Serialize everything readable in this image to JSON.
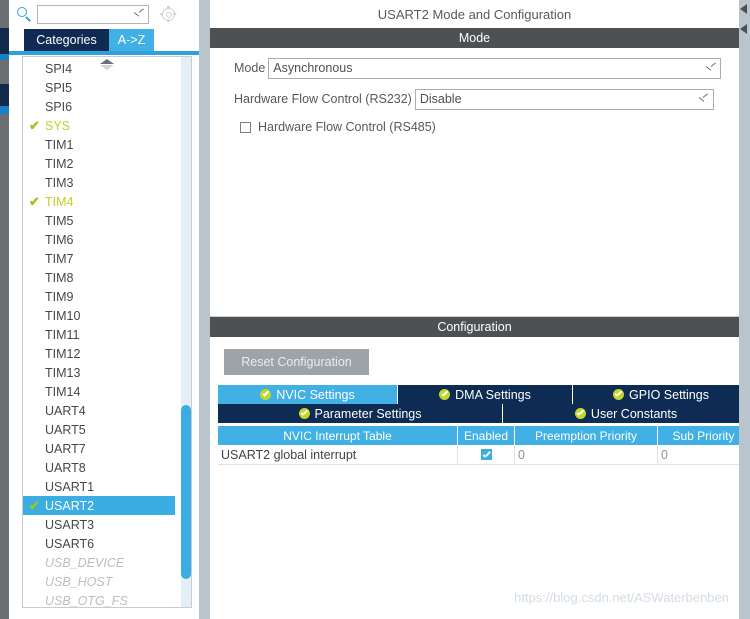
{
  "sidebar": {
    "search": {
      "placeholder": "",
      "value": "",
      "icon": "search-icon"
    },
    "settings_icon": "gear-icon",
    "tabs": [
      {
        "label": "Categories",
        "selected": true
      },
      {
        "label": "A->Z",
        "selected": false
      }
    ],
    "peripherals": [
      {
        "label": "SPI4",
        "state": "partial-top",
        "checked": false
      },
      {
        "label": "SPI5",
        "state": "normal",
        "checked": false
      },
      {
        "label": "SPI6",
        "state": "normal",
        "checked": false
      },
      {
        "label": "SYS",
        "state": "enabled",
        "checked": true
      },
      {
        "label": "TIM1",
        "state": "normal",
        "checked": false
      },
      {
        "label": "TIM2",
        "state": "normal",
        "checked": false
      },
      {
        "label": "TIM3",
        "state": "normal",
        "checked": false
      },
      {
        "label": "TIM4",
        "state": "enabled",
        "checked": true
      },
      {
        "label": "TIM5",
        "state": "normal",
        "checked": false
      },
      {
        "label": "TIM6",
        "state": "normal",
        "checked": false
      },
      {
        "label": "TIM7",
        "state": "normal",
        "checked": false
      },
      {
        "label": "TIM8",
        "state": "normal",
        "checked": false
      },
      {
        "label": "TIM9",
        "state": "normal",
        "checked": false
      },
      {
        "label": "TIM10",
        "state": "normal",
        "checked": false
      },
      {
        "label": "TIM11",
        "state": "normal",
        "checked": false
      },
      {
        "label": "TIM12",
        "state": "normal",
        "checked": false
      },
      {
        "label": "TIM13",
        "state": "normal",
        "checked": false
      },
      {
        "label": "TIM14",
        "state": "normal",
        "checked": false
      },
      {
        "label": "UART4",
        "state": "normal",
        "checked": false
      },
      {
        "label": "UART5",
        "state": "normal",
        "checked": false
      },
      {
        "label": "UART7",
        "state": "normal",
        "checked": false
      },
      {
        "label": "UART8",
        "state": "normal",
        "checked": false
      },
      {
        "label": "USART1",
        "state": "normal",
        "checked": false
      },
      {
        "label": "USART2",
        "state": "selected",
        "checked": true
      },
      {
        "label": "USART3",
        "state": "normal",
        "checked": false
      },
      {
        "label": "USART6",
        "state": "normal",
        "checked": false
      },
      {
        "label": "USB_DEVICE",
        "state": "disabled",
        "checked": false
      },
      {
        "label": "USB_HOST",
        "state": "disabled",
        "checked": false
      },
      {
        "label": "USB_OTG_FS",
        "state": "disabled",
        "checked": false
      }
    ]
  },
  "main": {
    "title": "USART2 Mode and Configuration",
    "mode_section": {
      "header": "Mode",
      "fields": [
        {
          "label": "Mode",
          "value": "Asynchronous"
        },
        {
          "label": "Hardware Flow Control (RS232)",
          "value": "Disable"
        }
      ],
      "checkbox": {
        "label": "Hardware Flow Control (RS485)",
        "checked": false
      }
    },
    "configuration_section": {
      "header": "Configuration",
      "reset_button": "Reset Configuration",
      "tabs_row1": [
        {
          "label": "NVIC Settings",
          "active": true
        },
        {
          "label": "DMA Settings",
          "active": false
        },
        {
          "label": "GPIO Settings",
          "active": false
        }
      ],
      "tabs_row2": [
        {
          "label": "Parameter Settings",
          "active": false
        },
        {
          "label": "User Constants",
          "active": false
        }
      ],
      "table": {
        "columns": [
          "NVIC Interrupt Table",
          "Enabled",
          "Preemption Priority",
          "Sub Priority"
        ],
        "rows": [
          {
            "name": "USART2 global interrupt",
            "enabled": true,
            "preemption_priority": "0",
            "sub_priority": "0"
          }
        ]
      }
    }
  },
  "watermark": "https://blog.csdn.net/ASWaterbenben",
  "colors": {
    "accent_blue": "#41b0e4",
    "dark_navy": "#0d2b53",
    "header_gray": "#4d5154",
    "check_green": "#9fc61e",
    "splitter": "#b9c4cc"
  }
}
